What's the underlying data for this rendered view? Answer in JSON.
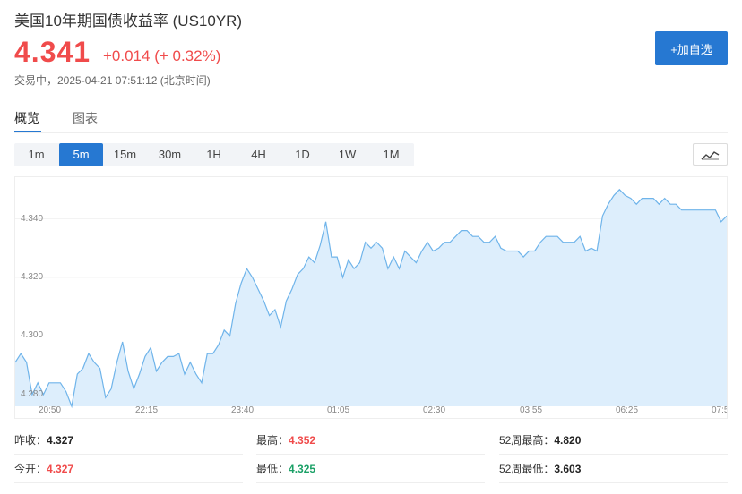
{
  "header": {
    "title": "美国10年期国债收益率  (US10YR)",
    "price": "4.341",
    "change": "+0.014 (+ 0.32%)",
    "status": "交易中，2025-04-21 07:51:12 (北京时间)",
    "add_button": "+加自选"
  },
  "tabs": [
    {
      "label": "概览",
      "active": true
    },
    {
      "label": "图表",
      "active": false
    }
  ],
  "periods": [
    "1m",
    "5m",
    "15m",
    "30m",
    "1H",
    "4H",
    "1D",
    "1W",
    "1M"
  ],
  "active_period": "5m",
  "colors": {
    "up": "#f04b4b",
    "down": "#1aa066",
    "accent": "#2678d2",
    "line": "#6fb4ea",
    "fill": "#ddeefc"
  },
  "chart_data": {
    "type": "area",
    "y_ticks": [
      "4.340",
      "4.320",
      "4.300",
      "4.280"
    ],
    "x_ticks": [
      "20:50",
      "22:15",
      "23:40",
      "01:05",
      "02:30",
      "03:55",
      "06:25",
      "07:5"
    ],
    "ylim": [
      4.276,
      4.353
    ],
    "values": [
      4.291,
      4.294,
      4.291,
      4.28,
      4.284,
      4.28,
      4.284,
      4.284,
      4.284,
      4.281,
      4.276,
      4.287,
      4.289,
      4.294,
      4.291,
      4.289,
      4.279,
      4.282,
      4.291,
      4.298,
      4.288,
      4.282,
      4.287,
      4.293,
      4.296,
      4.288,
      4.291,
      4.293,
      4.293,
      4.294,
      4.287,
      4.291,
      4.287,
      4.284,
      4.294,
      4.294,
      4.297,
      4.302,
      4.3,
      4.311,
      4.318,
      4.323,
      4.32,
      4.316,
      4.312,
      4.307,
      4.309,
      4.303,
      4.312,
      4.316,
      4.321,
      4.323,
      4.327,
      4.325,
      4.331,
      4.339,
      4.327,
      4.327,
      4.32,
      4.326,
      4.323,
      4.325,
      4.332,
      4.33,
      4.332,
      4.33,
      4.323,
      4.327,
      4.323,
      4.329,
      4.327,
      4.325,
      4.329,
      4.332,
      4.329,
      4.33,
      4.332,
      4.332,
      4.334,
      4.336,
      4.336,
      4.334,
      4.334,
      4.332,
      4.332,
      4.334,
      4.33,
      4.329,
      4.329,
      4.329,
      4.327,
      4.329,
      4.329,
      4.332,
      4.334,
      4.334,
      4.334,
      4.332,
      4.332,
      4.332,
      4.334,
      4.329,
      4.33,
      4.329,
      4.341,
      4.345,
      4.348,
      4.35,
      4.348,
      4.347,
      4.345,
      4.347,
      4.347,
      4.347,
      4.345,
      4.347,
      4.345,
      4.345,
      4.343,
      4.343,
      4.343,
      4.343,
      4.343,
      4.343,
      4.343,
      4.339,
      4.341
    ]
  },
  "stats": [
    {
      "label": "昨收：",
      "value": "4.327",
      "tone": "neutral"
    },
    {
      "label": "最高：",
      "value": "4.352",
      "tone": "up"
    },
    {
      "label": "52周最高：",
      "value": "4.820",
      "tone": "neutral"
    },
    {
      "label": "今开：",
      "value": "4.327",
      "tone": "up"
    },
    {
      "label": "最低：",
      "value": "4.325",
      "tone": "down"
    },
    {
      "label": "52周最低：",
      "value": "3.603",
      "tone": "neutral"
    }
  ]
}
